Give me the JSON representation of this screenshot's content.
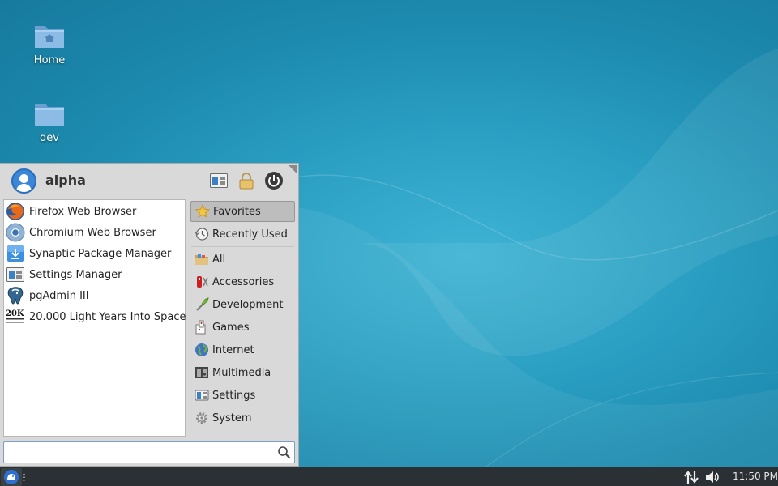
{
  "desktop": {
    "icons": [
      {
        "label": "Home",
        "icon": "home-folder-icon"
      },
      {
        "label": "dev",
        "icon": "folder-icon"
      }
    ]
  },
  "menu": {
    "username": "alpha",
    "header_buttons": [
      "settings-manager-icon",
      "lock-icon",
      "power-icon"
    ],
    "apps": [
      {
        "label": "Firefox Web Browser",
        "icon": "firefox-icon"
      },
      {
        "label": "Chromium Web Browser",
        "icon": "chromium-icon"
      },
      {
        "label": "Synaptic Package Manager",
        "icon": "synaptic-icon"
      },
      {
        "label": "Settings Manager",
        "icon": "settings-manager-icon"
      },
      {
        "label": "pgAdmin III",
        "icon": "pgadmin-icon"
      },
      {
        "label": "20.000 Light Years Into Space",
        "icon": "game-20k-icon",
        "icon_text": "20K"
      }
    ],
    "categories": [
      {
        "label": "Favorites",
        "icon": "star-icon",
        "active": true
      },
      {
        "label": "Recently Used",
        "icon": "history-icon"
      },
      {
        "label": "All",
        "icon": "all-apps-icon"
      },
      {
        "label": "Accessories",
        "icon": "accessories-icon"
      },
      {
        "label": "Development",
        "icon": "development-icon"
      },
      {
        "label": "Games",
        "icon": "games-icon"
      },
      {
        "label": "Internet",
        "icon": "internet-globe-icon"
      },
      {
        "label": "Multimedia",
        "icon": "multimedia-icon"
      },
      {
        "label": "Settings",
        "icon": "settings-icon"
      },
      {
        "label": "System",
        "icon": "system-gear-icon"
      }
    ],
    "search": {
      "value": "",
      "placeholder": ""
    }
  },
  "taskbar": {
    "clock": "11:50 PM"
  },
  "colors": {
    "wallpaper": "#1e8fb0",
    "menu_bg": "#d9d9d9",
    "active_category": "#bdbdbd",
    "taskbar": "#2b3034"
  }
}
